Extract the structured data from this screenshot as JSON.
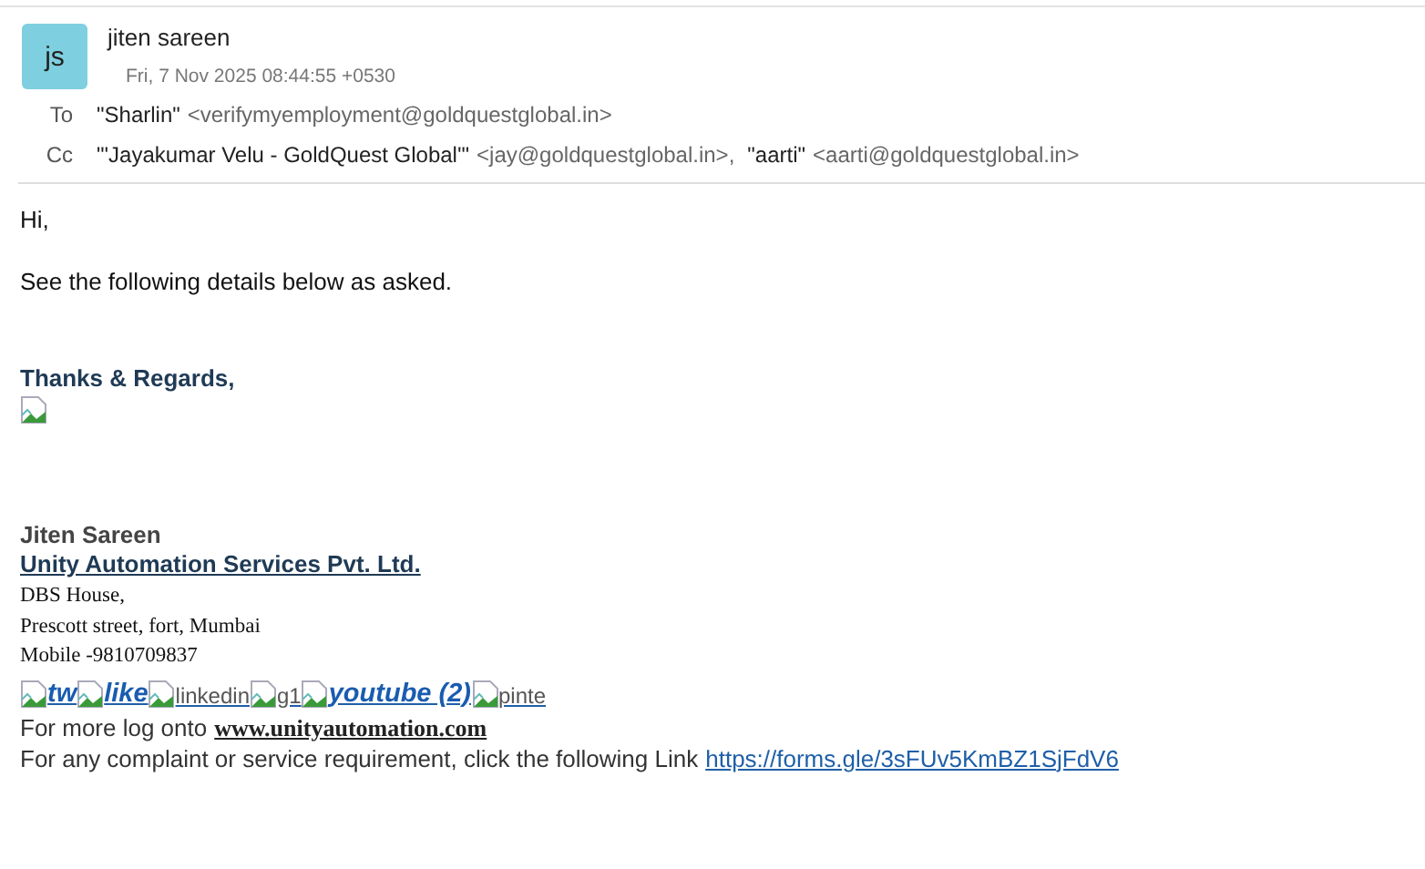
{
  "header": {
    "avatar_initials": "js",
    "sender_name": "jiten sareen",
    "date": "Fri, 7 Nov 2025 08:44:55 +0530",
    "recipients": [
      {
        "label": "To",
        "people": [
          {
            "name": "\"Sharlin\"",
            "address": "<verifymyemployment@goldquestglobal.in>"
          }
        ]
      },
      {
        "label": "Cc",
        "people": [
          {
            "name": "\"'Jayakumar Velu - GoldQuest Global'\"",
            "address": "<jay@goldquestglobal.in>,"
          },
          {
            "name": "\"aarti\"",
            "address": "<aarti@goldquestglobal.in>"
          }
        ]
      }
    ]
  },
  "body": {
    "greeting": "Hi,",
    "message": "See the following details below as asked.",
    "closing": "Thanks & Regards,",
    "signature": {
      "name": "Jiten Sareen",
      "company": "Unity Automation Services Pvt. Ltd.",
      "address_lines": [
        "DBS House,",
        "Prescott street, fort, Mumbai",
        "Mobile -9810709837"
      ],
      "social_links": [
        {
          "label": "tw",
          "kind": "bold"
        },
        {
          "label": "like",
          "kind": "bold"
        },
        {
          "label": "linkedin",
          "kind": "plain"
        },
        {
          "label": "g1",
          "kind": "plain"
        },
        {
          "label": "youtube (2)",
          "kind": "bold"
        },
        {
          "label": "pinte",
          "kind": "plain"
        }
      ],
      "website_text": "For more log onto",
      "website": "www.unityautomation.com",
      "complaint_text": "For any complaint or service requirement, click the following Link",
      "complaint_link": "https://forms.gle/3sFUv5KmBZ1SjFdV6"
    }
  }
}
